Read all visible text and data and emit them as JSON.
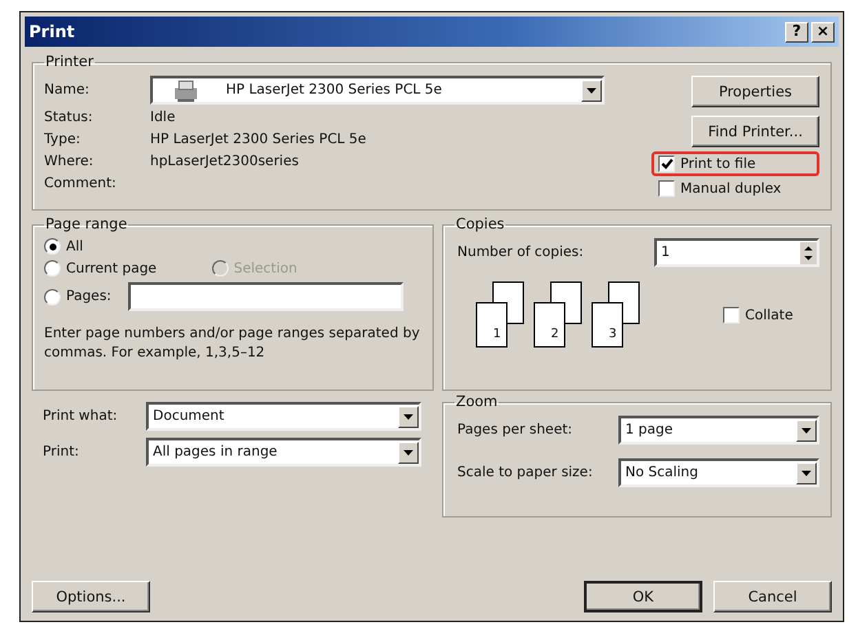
{
  "window": {
    "title": "Print",
    "help_button": "?",
    "close_button": "×"
  },
  "printer": {
    "legend": "Printer",
    "name_label": "Name:",
    "name_value": "HP LaserJet 2300 Series PCL 5e",
    "info": [
      {
        "label": "Status:",
        "value": "Idle"
      },
      {
        "label": "Type:",
        "value": "HP LaserJet 2300 Series PCL 5e"
      },
      {
        "label": "Where:",
        "value": "hpLaserJet2300series"
      },
      {
        "label": "Comment:"
      }
    ],
    "buttons": [
      "Properties",
      "Find Printer..."
    ],
    "checkboxes": [
      {
        "label": "Print to file",
        "checked": true,
        "highlighted": true
      },
      {
        "label": "Manual duplex",
        "checked": false,
        "highlighted": false
      }
    ]
  },
  "page_range": {
    "legend": "Page range",
    "options": [
      {
        "label": "All",
        "selected": true,
        "disabled": false
      },
      {
        "label": "Current page",
        "selected": false,
        "disabled": false
      },
      {
        "label": "Selection",
        "selected": false,
        "disabled": true
      },
      {
        "label": "Pages:",
        "selected": false,
        "disabled": false
      }
    ],
    "hint": "Enter page numbers and/or page ranges separated by commas.  For example, 1,3,5–12"
  },
  "copies": {
    "legend": "Copies",
    "label": "Number of copies:",
    "value": "1",
    "collate": {
      "label": "Collate",
      "checked": false
    },
    "page_numbers": [
      "1",
      "2",
      "3"
    ]
  },
  "print_what": {
    "label": "Print what:",
    "value": "Document"
  },
  "print": {
    "label": "Print:",
    "value": "All pages in range"
  },
  "zoom": {
    "legend": "Zoom",
    "rows": [
      {
        "label": "Pages per sheet:",
        "value": "1 page"
      },
      {
        "label": "Scale to paper size:",
        "value": "No Scaling"
      }
    ]
  },
  "footer": {
    "options": "Options...",
    "ok": "OK",
    "cancel": "Cancel"
  }
}
